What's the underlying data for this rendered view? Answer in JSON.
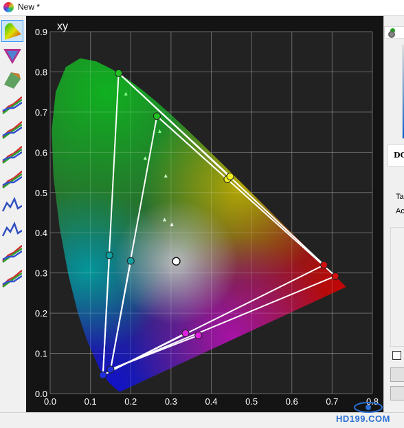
{
  "window": {
    "title": "New *"
  },
  "toolbar": {
    "tools": [
      {
        "name": "cie-chromaticity-tool",
        "icon": "chromaticity-diagram-icon",
        "selected": true
      },
      {
        "name": "gamut-triangle-tool",
        "icon": "gamut-triangle-icon",
        "selected": false
      },
      {
        "name": "3d-gamut-tool",
        "icon": "3d-gamut-icon",
        "selected": false
      },
      {
        "name": "rgb-curves-tool",
        "icon": "rgb-curves-icon",
        "selected": false
      },
      {
        "name": "rgb-balance-tool",
        "icon": "rgb-balance-icon",
        "selected": false
      },
      {
        "name": "gamma-tool",
        "icon": "gamma-curves-icon",
        "selected": false
      },
      {
        "name": "luminance-tool",
        "icon": "luminance-icon",
        "selected": false
      },
      {
        "name": "delta-e-tool",
        "icon": "delta-e-chart-icon",
        "selected": false
      },
      {
        "name": "grayscale-error-tool",
        "icon": "error-chart-icon",
        "selected": false
      },
      {
        "name": "color-error-tool",
        "icon": "color-error-icon",
        "selected": false
      },
      {
        "name": "comparison-tool",
        "icon": "comparison-chart-icon",
        "selected": false
      }
    ]
  },
  "right_panel": {
    "label_dc": "DC",
    "label_ta": "Ta",
    "label_ac": "Ac"
  },
  "watermark": {
    "text": "HD199.COM"
  },
  "chart_data": {
    "type": "scatter",
    "title": "",
    "corner_label": "xy",
    "xlim": [
      0.0,
      0.8
    ],
    "ylim": [
      0.0,
      0.9
    ],
    "x_ticks": [
      "0.0",
      "0.1",
      "0.2",
      "0.3",
      "0.4",
      "0.5",
      "0.6",
      "0.7",
      "0.8"
    ],
    "y_ticks": [
      "0.0",
      "0.1",
      "0.2",
      "0.3",
      "0.4",
      "0.5",
      "0.6",
      "0.7",
      "0.8",
      "0.9"
    ],
    "grid": true,
    "background": "#222222",
    "gamut_triangles": [
      {
        "points": [
          [
            0.17,
            0.797
          ],
          [
            0.68,
            0.32
          ],
          [
            0.131,
            0.046
          ]
        ]
      },
      {
        "points": [
          [
            0.265,
            0.69
          ],
          [
            0.708,
            0.292
          ],
          [
            0.15,
            0.06
          ]
        ]
      }
    ],
    "secondary_lines": [
      {
        "from": [
          0.17,
          0.797
        ],
        "to": [
          0.447,
          0.54
        ]
      },
      {
        "from": [
          0.265,
          0.69
        ],
        "to": [
          0.44,
          0.533
        ]
      },
      {
        "from": [
          0.131,
          0.046
        ],
        "to": [
          0.147,
          0.344
        ]
      },
      {
        "from": [
          0.15,
          0.06
        ],
        "to": [
          0.2,
          0.33
        ]
      },
      {
        "from": [
          0.131,
          0.046
        ],
        "to": [
          0.336,
          0.15
        ]
      },
      {
        "from": [
          0.15,
          0.06
        ],
        "to": [
          0.368,
          0.145
        ]
      }
    ],
    "points": [
      {
        "name": "green-primary-1",
        "x": 0.17,
        "y": 0.797,
        "color": "#22c022"
      },
      {
        "name": "green-primary-2",
        "x": 0.265,
        "y": 0.69,
        "color": "#22c022"
      },
      {
        "name": "red-primary-1",
        "x": 0.68,
        "y": 0.32,
        "color": "#d01010"
      },
      {
        "name": "red-primary-2",
        "x": 0.708,
        "y": 0.292,
        "color": "#d01010"
      },
      {
        "name": "blue-primary-1",
        "x": 0.131,
        "y": 0.046,
        "color": "#2030e0"
      },
      {
        "name": "blue-primary-2",
        "x": 0.15,
        "y": 0.06,
        "color": "#2030e0"
      },
      {
        "name": "yellow-secondary-1",
        "x": 0.44,
        "y": 0.533,
        "color": "#f0f020"
      },
      {
        "name": "yellow-secondary-2",
        "x": 0.447,
        "y": 0.54,
        "color": "#f0f020"
      },
      {
        "name": "cyan-secondary-1",
        "x": 0.147,
        "y": 0.344,
        "color": "#10a0a0"
      },
      {
        "name": "cyan-secondary-2",
        "x": 0.2,
        "y": 0.33,
        "color": "#10a0a0"
      },
      {
        "name": "magenta-secondary-1",
        "x": 0.336,
        "y": 0.15,
        "color": "#e020e0"
      },
      {
        "name": "magenta-secondary-2",
        "x": 0.368,
        "y": 0.145,
        "color": "#e020e0"
      },
      {
        "name": "white-point",
        "x": 0.313,
        "y": 0.329,
        "color": "#ffffff"
      }
    ],
    "small_markers": [
      {
        "x": 0.188,
        "y": 0.745,
        "color": "#88ff88"
      },
      {
        "x": 0.272,
        "y": 0.652,
        "color": "#88ff88"
      },
      {
        "x": 0.236,
        "y": 0.585,
        "color": "#aaffaa"
      },
      {
        "x": 0.287,
        "y": 0.541,
        "color": "#ccffcc"
      },
      {
        "x": 0.284,
        "y": 0.432,
        "color": "#ddffdd"
      },
      {
        "x": 0.302,
        "y": 0.42,
        "color": "#ffffff"
      }
    ]
  }
}
